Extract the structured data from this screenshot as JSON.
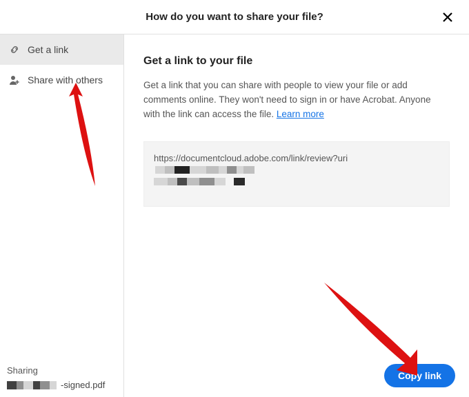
{
  "header": {
    "title": "How do you want to share your file?"
  },
  "sidebar": {
    "items": [
      {
        "label": "Get a link"
      },
      {
        "label": "Share with others"
      }
    ],
    "sharing_label": "Sharing",
    "filename_suffix": "-signed.pdf"
  },
  "main": {
    "title": "Get a link to your file",
    "desc_part1": "Get a link that you can share with people to view your file or add comments online. They won't need to sign in or have Acrobat. Anyone with the link can access the file. ",
    "learn_more": "Learn more",
    "link_prefix": "https://documentcloud.adobe.com/link/review?uri",
    "copy_button": "Copy link"
  }
}
